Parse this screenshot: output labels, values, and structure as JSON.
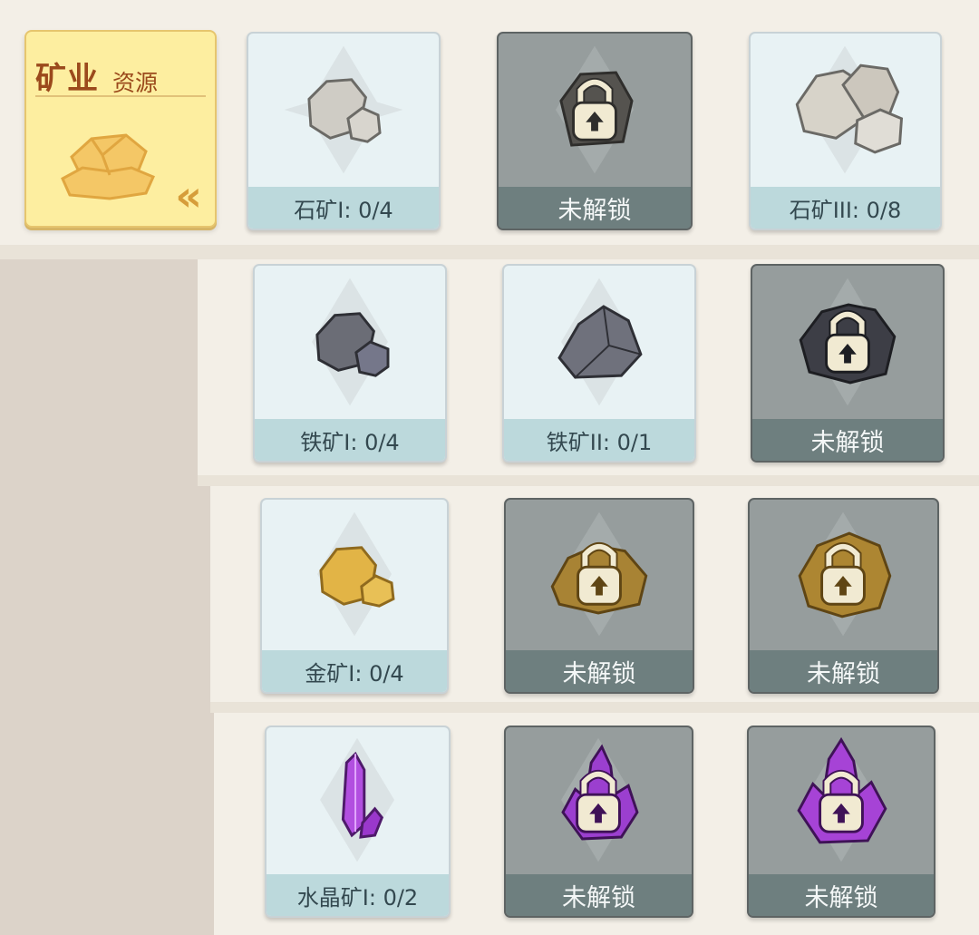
{
  "category": {
    "title": "矿业",
    "subtitle": "资源",
    "collapse_icon": "double-chevron-left-icon"
  },
  "rows": [
    {
      "cards": [
        {
          "label": "石矿I: 0/4",
          "locked": false,
          "icon": "stone-ore-icon"
        },
        {
          "label": "未解锁",
          "locked": true,
          "icon": "lock-icon"
        },
        {
          "label": "石矿III: 0/8",
          "locked": false,
          "icon": "stone-ore-icon"
        }
      ]
    },
    {
      "cards": [
        {
          "label": "铁矿I: 0/4",
          "locked": false,
          "icon": "iron-ore-icon"
        },
        {
          "label": "铁矿II: 0/1",
          "locked": false,
          "icon": "iron-ore-icon"
        },
        {
          "label": "未解锁",
          "locked": true,
          "icon": "lock-icon"
        }
      ]
    },
    {
      "cards": [
        {
          "label": "金矿I: 0/4",
          "locked": false,
          "icon": "gold-ore-icon"
        },
        {
          "label": "未解锁",
          "locked": true,
          "icon": "lock-icon"
        },
        {
          "label": "未解锁",
          "locked": true,
          "icon": "lock-icon"
        }
      ]
    },
    {
      "cards": [
        {
          "label": "水晶矿I: 0/2",
          "locked": false,
          "icon": "crystal-ore-icon"
        },
        {
          "label": "未解锁",
          "locked": true,
          "icon": "lock-icon"
        },
        {
          "label": "未解锁",
          "locked": true,
          "icon": "lock-icon"
        }
      ]
    }
  ],
  "colors": {
    "stone": "#cfccc5",
    "iron": "#5b5d66",
    "gold": "#e2b446",
    "gold_dark": "#a88334",
    "crystal": "#a43fd0",
    "lock": "#f1ead2"
  }
}
